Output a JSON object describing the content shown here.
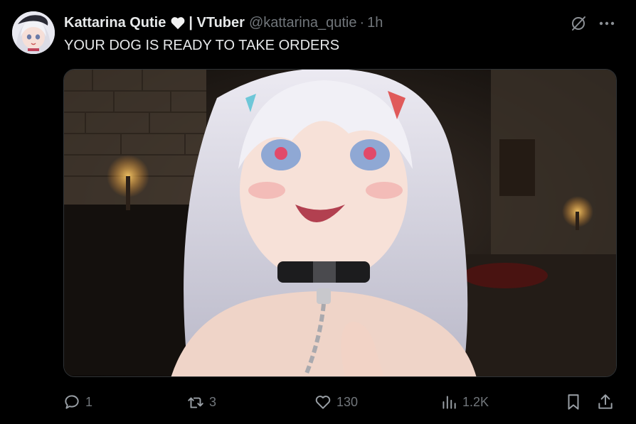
{
  "tweet": {
    "display_name": "Kattarina Qutie",
    "name_emoji": "white-heart-icon",
    "name_suffix": "| VTuber",
    "handle": "@kattarina_qutie",
    "separator": "·",
    "time": "1h",
    "text": "YOUR DOG IS READY TO TAKE ORDERS"
  },
  "icons": {
    "grok": "grok-icon",
    "more": "more-icon"
  },
  "actions": {
    "reply": {
      "icon": "reply-icon",
      "count": "1"
    },
    "repost": {
      "icon": "repost-icon",
      "count": "3"
    },
    "like": {
      "icon": "heart-icon",
      "count": "130"
    },
    "views": {
      "icon": "views-icon",
      "count": "1.2K"
    },
    "bookmark": {
      "icon": "bookmark-icon"
    },
    "share": {
      "icon": "share-icon"
    }
  },
  "colors": {
    "background": "#000000",
    "text": "#e7e9ea",
    "muted": "#71767b",
    "border": "#2f3336"
  }
}
